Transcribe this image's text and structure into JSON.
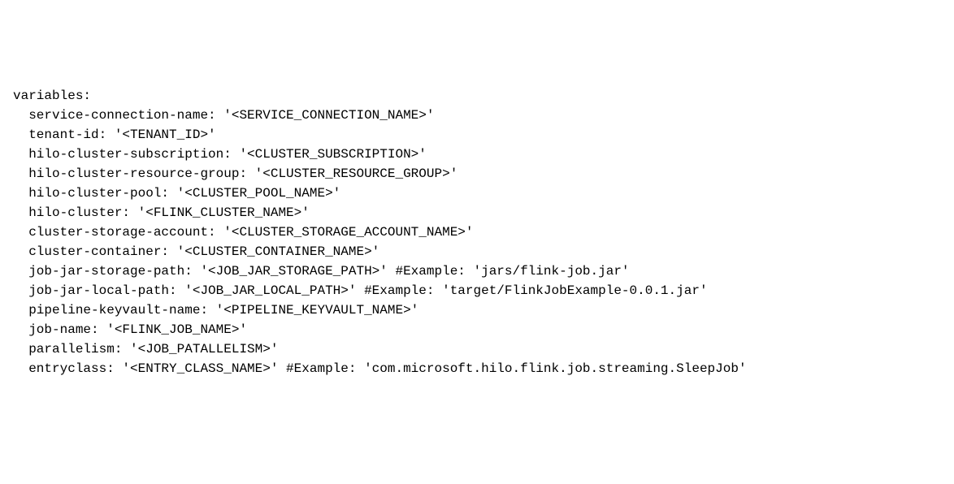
{
  "code": {
    "header": "variables:",
    "lines": [
      "service-connection-name: '<SERVICE_CONNECTION_NAME>'",
      "tenant-id: '<TENANT_ID>'",
      "",
      "hilo-cluster-subscription: '<CLUSTER_SUBSCRIPTION>'",
      "hilo-cluster-resource-group: '<CLUSTER_RESOURCE_GROUP>'",
      "hilo-cluster-pool: '<CLUSTER_POOL_NAME>'",
      "hilo-cluster: '<FLINK_CLUSTER_NAME>'",
      "",
      "",
      "cluster-storage-account: '<CLUSTER_STORAGE_ACCOUNT_NAME>'",
      "cluster-container: '<CLUSTER_CONTAINER_NAME>'",
      "",
      "job-jar-storage-path: '<JOB_JAR_STORAGE_PATH>' #Example: 'jars/flink-job.jar'",
      "job-jar-local-path: '<JOB_JAR_LOCAL_PATH>' #Example: 'target/FlinkJobExample-0.0.1.jar'",
      "",
      "",
      "pipeline-keyvault-name: '<PIPELINE_KEYVAULT_NAME>'",
      "job-name: '<FLINK_JOB_NAME>'",
      "parallelism: '<JOB_PATALLELISM>'",
      "entryclass: '<ENTRY_CLASS_NAME>' #Example: 'com.microsoft.hilo.flink.job.streaming.SleepJob'"
    ]
  }
}
